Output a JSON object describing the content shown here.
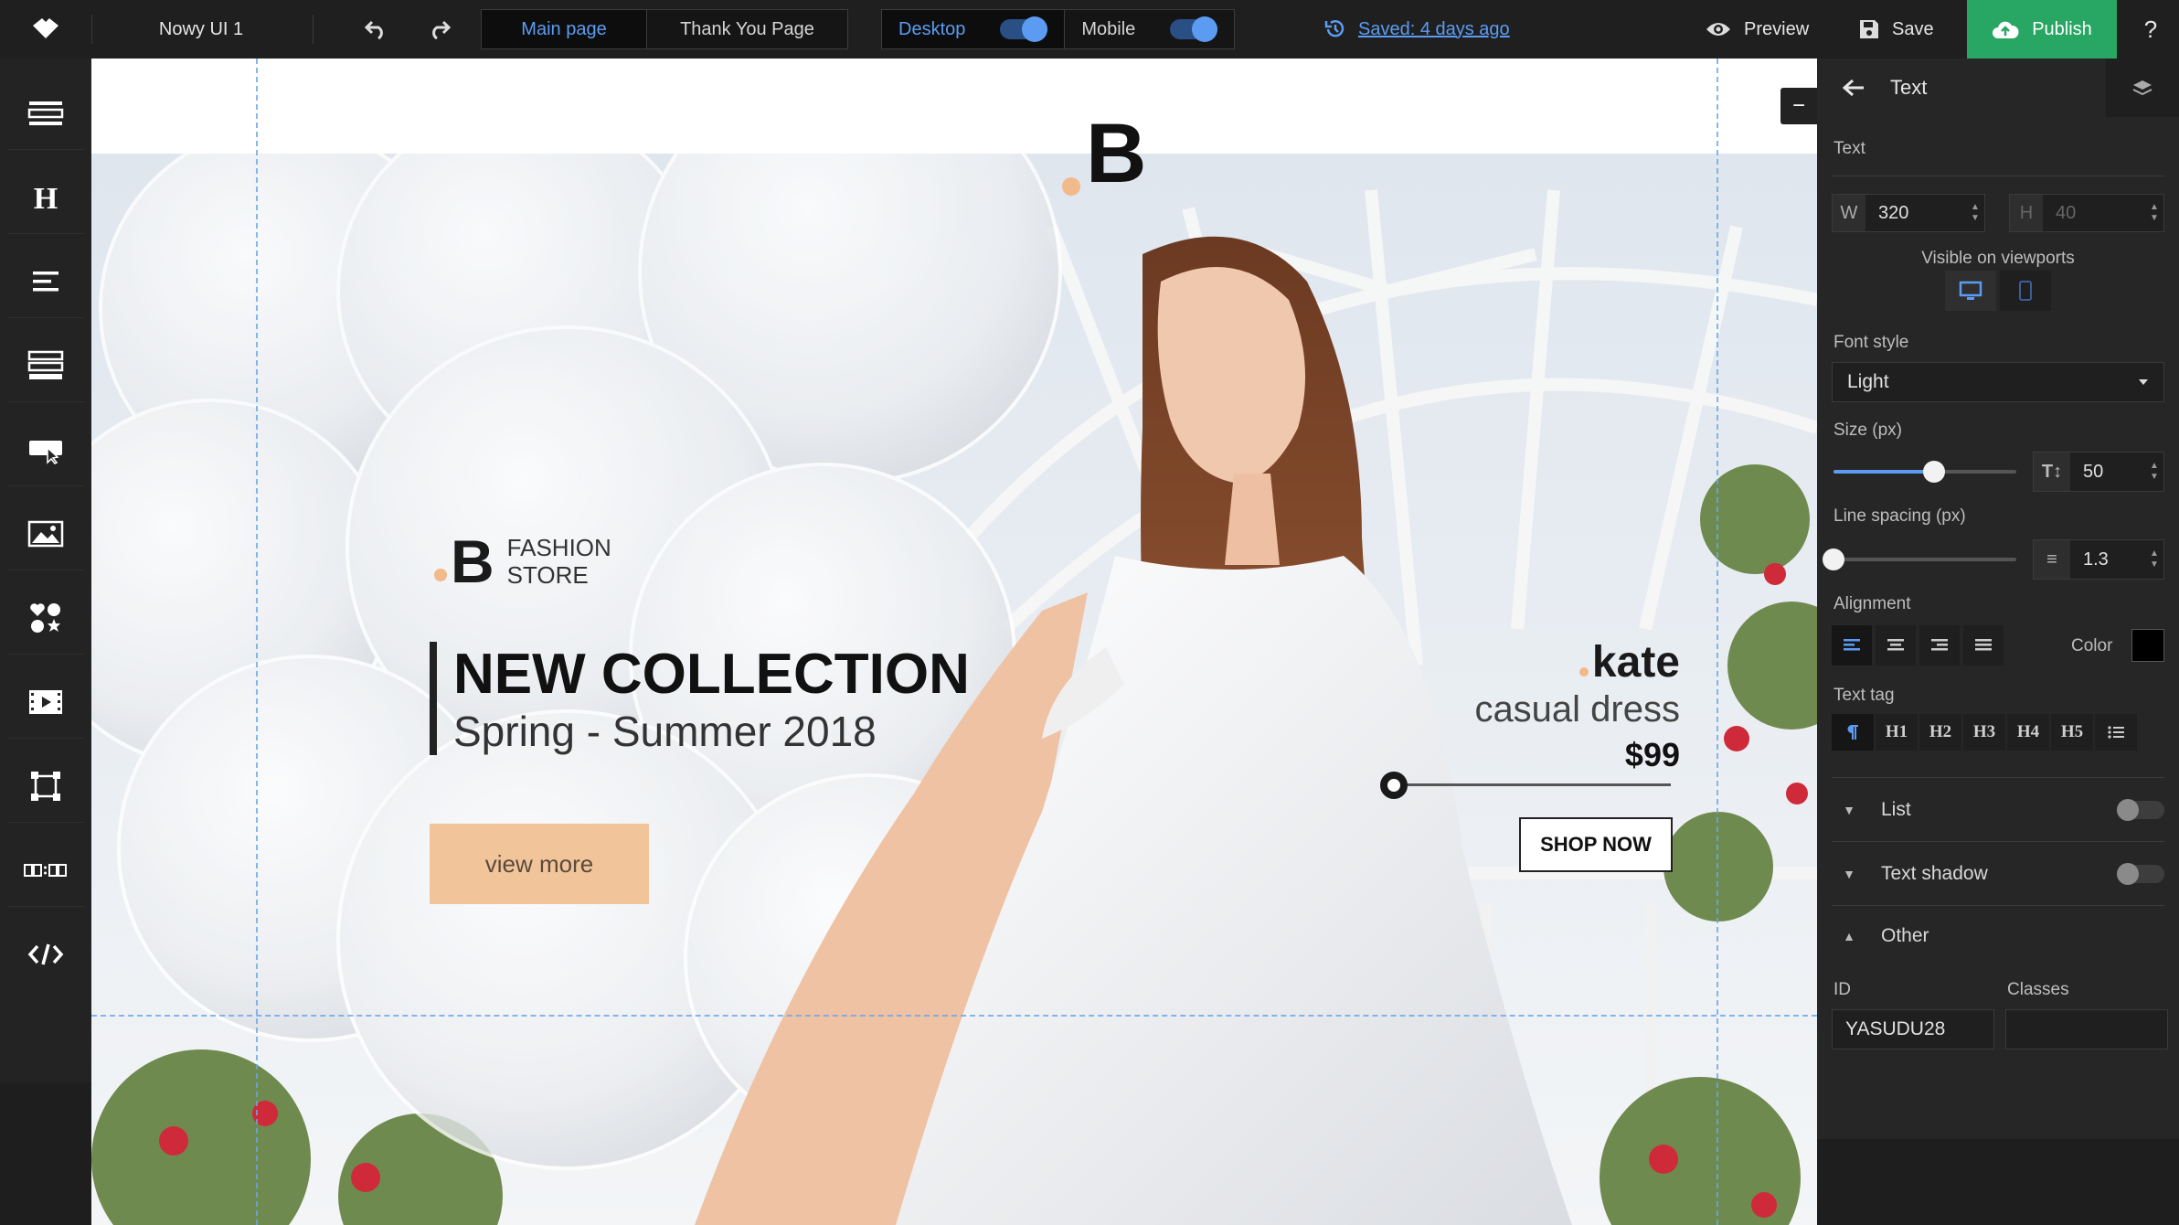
{
  "topbar": {
    "project_name": "Nowy UI 1",
    "tabs": [
      {
        "label": "Main page",
        "active": true
      },
      {
        "label": "Thank You Page",
        "active": false
      }
    ],
    "viewports": {
      "desktop_label": "Desktop",
      "mobile_label": "Mobile"
    },
    "saved_text": "Saved: 4 days ago",
    "preview_label": "Preview",
    "save_label": "Save",
    "publish_label": "Publish",
    "help_label": "?"
  },
  "canvas": {
    "logo_letter": "B",
    "brand": {
      "letter": "B",
      "line1": "FASHION",
      "line2": "STORE"
    },
    "headline": "NEW COLLECTION",
    "subheadline": "Spring - Summer 2018",
    "view_more": "view more",
    "model_name": "kate",
    "product": "casual dress",
    "price": "$99",
    "shop_now": "SHOP NOW",
    "collapse_symbol": "−"
  },
  "left_tools": [
    {
      "name": "section-tool"
    },
    {
      "name": "heading-tool"
    },
    {
      "name": "text-tool"
    },
    {
      "name": "form-tool"
    },
    {
      "name": "button-tool"
    },
    {
      "name": "image-tool"
    },
    {
      "name": "icons-tool"
    },
    {
      "name": "video-tool"
    },
    {
      "name": "box-tool"
    },
    {
      "name": "timer-tool"
    },
    {
      "name": "code-tool"
    }
  ],
  "panel": {
    "title": "Text",
    "section_label": "Text",
    "width": {
      "key": "W",
      "value": "320"
    },
    "height": {
      "key": "H",
      "value": "40"
    },
    "visible_on_viewports": "Visible on viewports",
    "font_style_label": "Font style",
    "font_style_value": "Light",
    "size_label": "Size (px)",
    "size_value": "50",
    "size_fraction": 0.55,
    "line_spacing_label": "Line spacing (px)",
    "line_spacing_value": "1.3",
    "line_spacing_fraction": 0.0,
    "alignment_label": "Alignment",
    "color_label": "Color",
    "text_color": "#000000",
    "text_tag_label": "Text tag",
    "text_tags": [
      "H1",
      "H2",
      "H3",
      "H4",
      "H5"
    ],
    "list_label": "List",
    "text_shadow_label": "Text shadow",
    "other_label": "Other",
    "id_label": "ID",
    "id_value": "YASUDU28",
    "classes_label": "Classes",
    "classes_value": ""
  },
  "colors": {
    "accent": "#5b9cf2",
    "publish": "#28a663",
    "button_peach": "#f2c49a"
  }
}
